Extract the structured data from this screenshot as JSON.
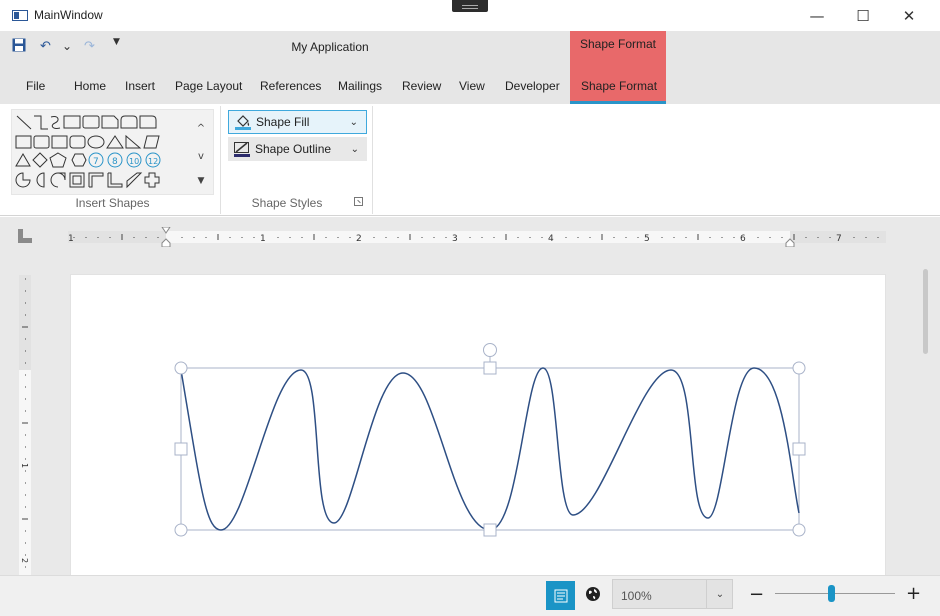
{
  "window": {
    "title": "MainWindow",
    "minimize_glyph": "—",
    "maximize_glyph": "☐",
    "close_glyph": "✕"
  },
  "quick_access": {
    "save_icon": "save-icon",
    "undo_icon": "undo-icon",
    "undo_dropdown_icon": "chevron-down-icon",
    "redo_icon": "redo-icon",
    "customize_icon": "customize-icon",
    "undo_glyph": "↶",
    "dropdown_glyph": "⌄",
    "redo_glyph": "↷",
    "customize_glyph": "▼"
  },
  "app_name": "My Application",
  "contextual": {
    "title": "Shape Format",
    "color": "#e8696a",
    "underline_color": "#2a94c8"
  },
  "tabs": [
    {
      "label": "File"
    },
    {
      "label": "Home"
    },
    {
      "label": "Insert"
    },
    {
      "label": "Page Layout"
    },
    {
      "label": "References"
    },
    {
      "label": "Mailings"
    },
    {
      "label": "Review"
    },
    {
      "label": "View"
    },
    {
      "label": "Developer"
    },
    {
      "label": "Shape Format",
      "active": true
    }
  ],
  "insert_shapes": {
    "label": "Insert Shapes",
    "scroll_up_glyph": "^",
    "scroll_down_glyph": "v",
    "more_glyph": "▼",
    "numbered_shapes": [
      "7",
      "8",
      "10",
      "12"
    ]
  },
  "shape_styles": {
    "label": "Shape Styles",
    "fill_label": "Shape Fill",
    "outline_label": "Shape Outline",
    "caret_glyph": "⌄",
    "accent_color": "#3fa9dd"
  },
  "ruler": {
    "h_numbers": [
      "1",
      "1",
      "2",
      "3",
      "4",
      "5",
      "6",
      "7"
    ],
    "v_numbers": [
      "1",
      "2"
    ]
  },
  "status": {
    "zoom_value": "100%",
    "zoom_dropdown_glyph": "⌄",
    "zoom_minus": "−",
    "zoom_plus": "+",
    "zoom_level": 0.47,
    "accent_color": "#1a94c6"
  }
}
